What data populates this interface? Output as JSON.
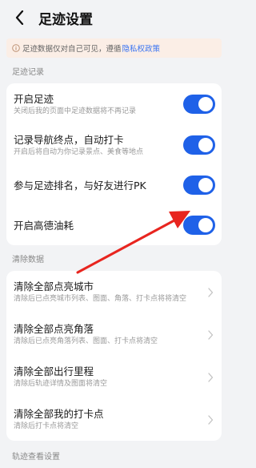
{
  "header": {
    "title": "足迹设置"
  },
  "notice": {
    "text": "足迹数据仅对自己可见，遵循",
    "link": "隐私权政策"
  },
  "sections": {
    "footprint_label": "足迹记录",
    "clear_label": "清除数据",
    "track_label": "轨迹查看设置"
  },
  "footprint_settings": [
    {
      "title": "开启足迹",
      "subtitle": "关闭后我的页面中足迹数据将不再记录",
      "on": true
    },
    {
      "title": "记录导航终点，自动打卡",
      "subtitle": "开启后将自动为你记录景点、美食等地点",
      "on": true
    },
    {
      "title": "参与足迹排名，与好友进行PK",
      "subtitle": "",
      "on": true
    },
    {
      "title": "开启高德油耗",
      "subtitle": "",
      "on": true
    }
  ],
  "clear_items": [
    {
      "title": "清除全部点亮城市",
      "subtitle": "清除后已点亮城市列表、图面、角落、打卡点将将清空"
    },
    {
      "title": "清除全部点亮角落",
      "subtitle": "清除后已点亮角落列表、图面、打卡点将清空"
    },
    {
      "title": "清除全部出行里程",
      "subtitle": "清除后轨迹详情及图面将清空"
    },
    {
      "title": "清除全部我的打卡点",
      "subtitle": "清除后打卡点将清空"
    }
  ],
  "icons": {
    "back": "back-arrow-icon",
    "info": "info-icon",
    "chevron": "chevron-right-icon"
  },
  "colors": {
    "toggle_on": "#1f61e8",
    "link": "#3a74f2",
    "annotation_arrow": "#e8251f",
    "notice_bg": "#fbeee6"
  }
}
